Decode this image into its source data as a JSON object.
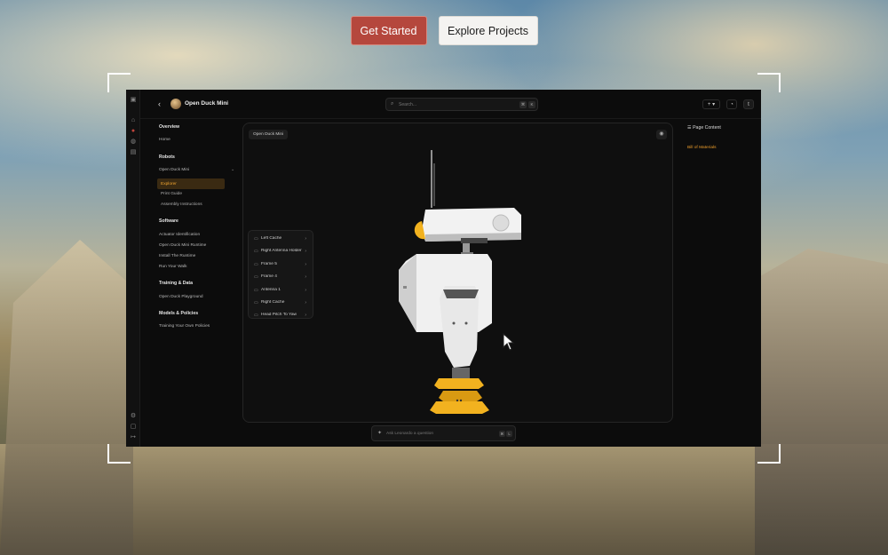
{
  "cta": {
    "primary_label": "Get Started",
    "secondary_label": "Explore Projects"
  },
  "app": {
    "project_title": "Open Duck Mini",
    "search_placeholder": "Search...",
    "search_shortcut": [
      "⌘",
      "K"
    ],
    "top_right": {
      "add_label": "+ ▾",
      "user_initial": "t"
    },
    "sidebar": {
      "sections": [
        {
          "title": "Overview",
          "items": [
            "Home"
          ]
        },
        {
          "title": "Robots",
          "items": [
            "Open Duck Mini"
          ],
          "sub_items": [
            "Explorer",
            "Print Guide",
            "Assembly Instructions"
          ],
          "active": "Explorer"
        },
        {
          "title": "Software",
          "items": [
            "Actuator Identification",
            "Open Duck Mini Runtime",
            "Install The Runtime",
            "Run Your Walk"
          ]
        },
        {
          "title": "Training & Data",
          "items": [
            "Open Duck Playground"
          ]
        },
        {
          "title": "Models & Policies",
          "items": [
            "Training Your Own Policies"
          ]
        }
      ]
    },
    "viewer": {
      "label": "Open Duck Mini",
      "parts": [
        "Left Cache",
        "Right Antenna Holder",
        "Frame 5",
        "Frame 4",
        "Antenna 1",
        "Right Cache",
        "Head Pitch To Yaw"
      ]
    },
    "page_content": {
      "title": "Page Content",
      "links": [
        "Bill of Materials"
      ]
    },
    "ask": {
      "placeholder": "Ask Leonardo a question",
      "shortcut": [
        "⌘",
        "L"
      ]
    },
    "colors": {
      "accent": "#f0a530",
      "primary_button": "#b5473d",
      "robot_yellow": "#f2b21f"
    }
  }
}
